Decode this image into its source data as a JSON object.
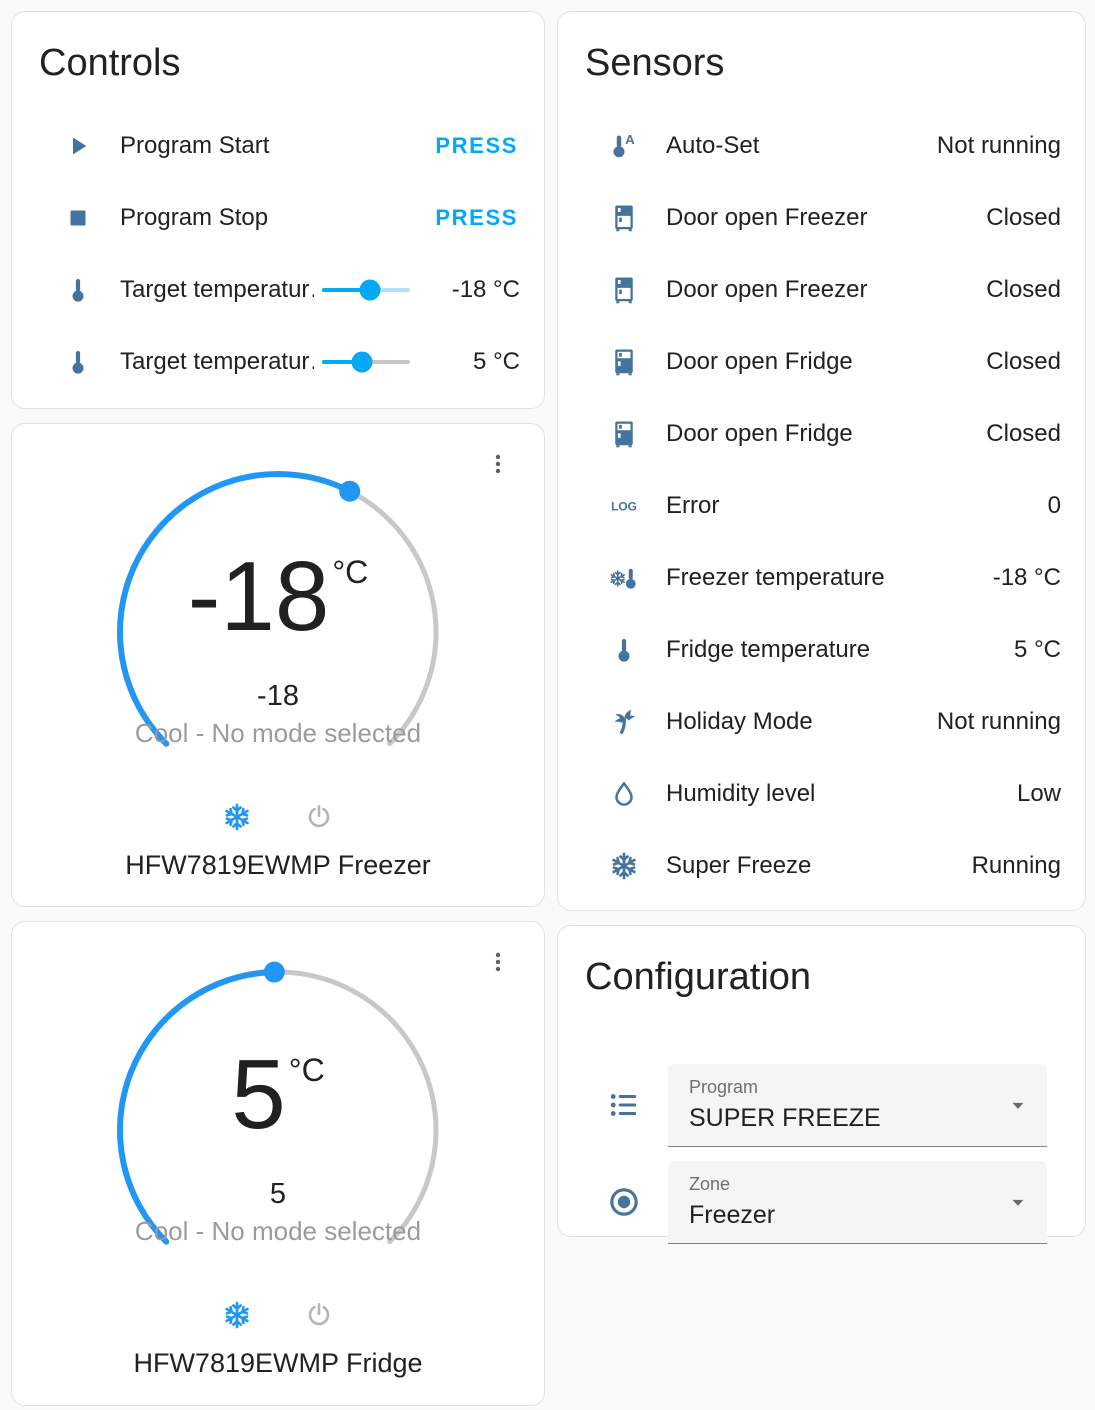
{
  "colors": {
    "accent": "#03a9f4",
    "dial_active": "#2196f3",
    "dial_inactive": "#c8c8c8",
    "icon": "#44739e",
    "status_text": "#9b9b9b",
    "primary_text": "#212121",
    "slider_inactive_blue": "#b3e1f8",
    "slider_inactive_gray": "#c6c6c6"
  },
  "controls": {
    "title": "Controls",
    "rows": [
      {
        "icon": "play-icon",
        "label": "Program Start",
        "action": "PRESS"
      },
      {
        "icon": "stop-icon",
        "label": "Program Stop",
        "action": "PRESS"
      },
      {
        "icon": "thermometer-icon",
        "label": "Target temperatur…",
        "value": "-18 °C",
        "slider_percent": 55
      },
      {
        "icon": "thermometer-icon",
        "label": "Target temperatur…",
        "value": "5 °C",
        "slider_percent": 46
      }
    ]
  },
  "thermostats": [
    {
      "name": "HFW7819EWMP Freezer",
      "value": "-18",
      "unit": "°C",
      "current": "-18",
      "status": "Cool - No mode selected",
      "dial_fraction": 0.6,
      "modes": [
        {
          "icon": "snowflake-icon",
          "active": true
        },
        {
          "icon": "power-icon",
          "active": false
        }
      ]
    },
    {
      "name": "HFW7819EWMP Fridge",
      "value": "5",
      "unit": "°C",
      "current": "5",
      "status": "Cool - No mode selected",
      "dial_fraction": 0.495,
      "modes": [
        {
          "icon": "snowflake-icon",
          "active": true
        },
        {
          "icon": "power-icon",
          "active": false
        }
      ]
    }
  ],
  "sensors": {
    "title": "Sensors",
    "rows": [
      {
        "icon": "thermometer-auto-icon",
        "label": "Auto-Set",
        "value": "Not running"
      },
      {
        "icon": "fridge-top-icon",
        "label": "Door open Freezer",
        "value": "Closed"
      },
      {
        "icon": "fridge-top-icon",
        "label": "Door open Freezer",
        "value": "Closed"
      },
      {
        "icon": "fridge-bottom-icon",
        "label": "Door open Fridge",
        "value": "Closed"
      },
      {
        "icon": "fridge-bottom-icon",
        "label": "Door open Fridge",
        "value": "Closed"
      },
      {
        "icon": "log-icon",
        "label": "Error",
        "value": "0"
      },
      {
        "icon": "snowflake-thermometer-icon",
        "label": "Freezer temperature",
        "value": "-18 °C"
      },
      {
        "icon": "thermometer-icon",
        "label": "Fridge temperature",
        "value": "5 °C"
      },
      {
        "icon": "palm-tree-icon",
        "label": "Holiday Mode",
        "value": "Not running"
      },
      {
        "icon": "water-outline-icon",
        "label": "Humidity level",
        "value": "Low"
      },
      {
        "icon": "snowflake-icon",
        "label": "Super Freeze",
        "value": "Running"
      }
    ]
  },
  "configuration": {
    "title": "Configuration",
    "fields": [
      {
        "icon": "format-list-bulleted-icon",
        "label": "Program",
        "value": "SUPER FREEZE"
      },
      {
        "icon": "radiobox-marked-icon",
        "label": "Zone",
        "value": "Freezer"
      }
    ]
  }
}
